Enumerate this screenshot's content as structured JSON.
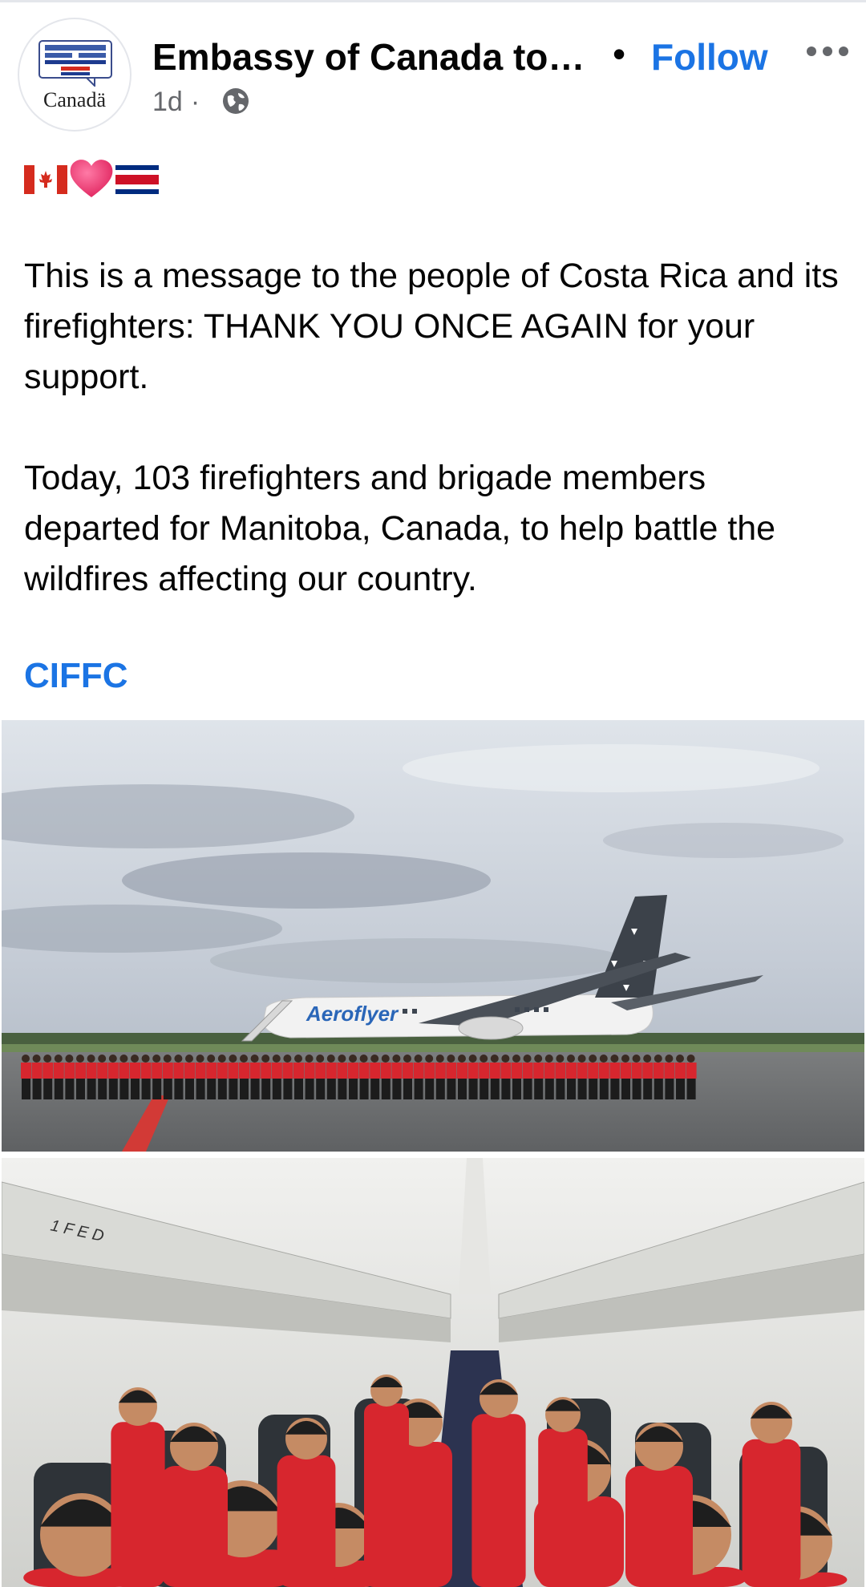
{
  "post": {
    "page_name": "Embassy of Canada to ...",
    "separator": "•",
    "follow_label": "Follow",
    "timestamp": "1d",
    "meta_separator": "·",
    "avatar_wordmark": "Canadä",
    "emoji_line": [
      "flag-canada-icon",
      "heart-icon",
      "flag-costa-rica-icon"
    ],
    "paragraphs": [
      "This is a message to the people of Costa Rica and its firefighters: THANK YOU ONCE AGAIN for your support.",
      "Today, 103 firefighters and brigade members departed for Manitoba, Canada, to help battle the wildfires affecting our country."
    ],
    "hashtag": "CIFFC",
    "photos": [
      {
        "name": "firefighters-in-front-of-airplane",
        "airline_text": "Aeroflyer"
      },
      {
        "name": "firefighters-inside-airplane-cabin",
        "overhead_label": "1 F E D"
      }
    ]
  },
  "colors": {
    "link_blue": "#1b74e4",
    "meta_grey": "#65676b",
    "uniform_red": "#d7262e"
  }
}
